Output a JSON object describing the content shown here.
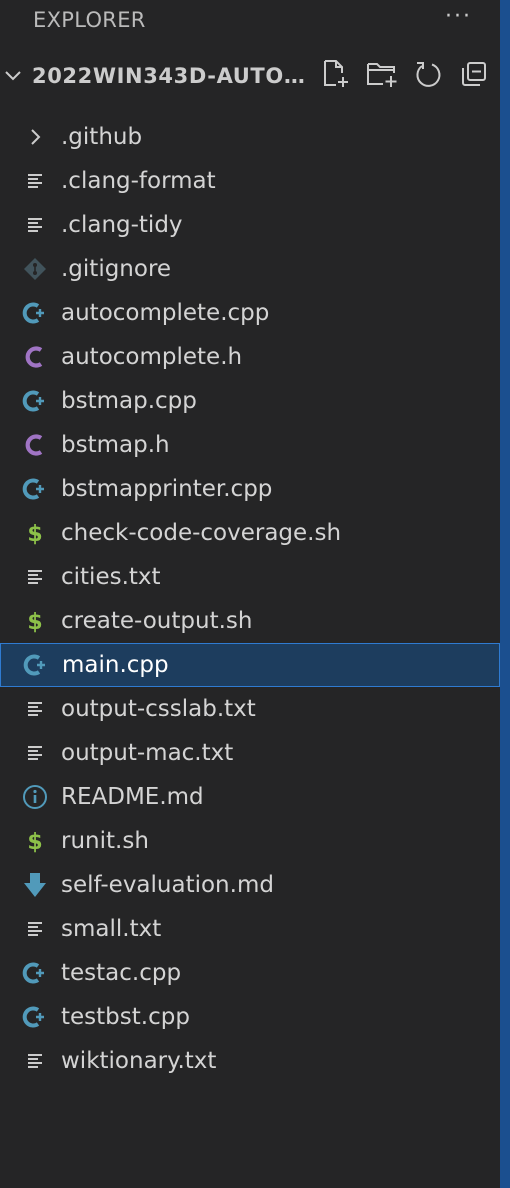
{
  "header": {
    "title": "EXPLORER",
    "more_label": "···"
  },
  "folder": {
    "name": "2022WIN343D-AUTOC...",
    "actions": [
      "new-file-icon",
      "new-folder-icon",
      "refresh-icon",
      "collapse-all-icon"
    ]
  },
  "files": [
    {
      "label": ".github",
      "icon": "chevron-right-icon",
      "kind": "folder"
    },
    {
      "label": ".clang-format",
      "icon": "text-file-icon",
      "kind": "file"
    },
    {
      "label": ".clang-tidy",
      "icon": "text-file-icon",
      "kind": "file"
    },
    {
      "label": ".gitignore",
      "icon": "git-icon",
      "kind": "file"
    },
    {
      "label": "autocomplete.cpp",
      "icon": "cpp-icon",
      "kind": "file"
    },
    {
      "label": "autocomplete.h",
      "icon": "c-header-icon",
      "kind": "file"
    },
    {
      "label": "bstmap.cpp",
      "icon": "cpp-icon",
      "kind": "file"
    },
    {
      "label": "bstmap.h",
      "icon": "c-header-icon",
      "kind": "file"
    },
    {
      "label": "bstmapprinter.cpp",
      "icon": "cpp-icon",
      "kind": "file"
    },
    {
      "label": "check-code-coverage.sh",
      "icon": "shell-icon",
      "kind": "file"
    },
    {
      "label": "cities.txt",
      "icon": "text-file-icon",
      "kind": "file"
    },
    {
      "label": "create-output.sh",
      "icon": "shell-icon",
      "kind": "file"
    },
    {
      "label": "main.cpp",
      "icon": "cpp-icon",
      "kind": "file",
      "selected": true
    },
    {
      "label": "output-csslab.txt",
      "icon": "text-file-icon",
      "kind": "file"
    },
    {
      "label": "output-mac.txt",
      "icon": "text-file-icon",
      "kind": "file"
    },
    {
      "label": "README.md",
      "icon": "info-icon",
      "kind": "file"
    },
    {
      "label": "runit.sh",
      "icon": "shell-icon",
      "kind": "file"
    },
    {
      "label": "self-evaluation.md",
      "icon": "markdown-download-icon",
      "kind": "file"
    },
    {
      "label": "small.txt",
      "icon": "text-file-icon",
      "kind": "file"
    },
    {
      "label": "testac.cpp",
      "icon": "cpp-icon",
      "kind": "file"
    },
    {
      "label": "testbst.cpp",
      "icon": "cpp-icon",
      "kind": "file"
    },
    {
      "label": "wiktionary.txt",
      "icon": "text-file-icon",
      "kind": "file"
    }
  ],
  "colors": {
    "background": "#252526",
    "selection": "#1d3d5e",
    "selection_border": "#2f7bd1",
    "cpp_icon": "#519aba",
    "c_header_icon": "#a074c4",
    "shell_icon": "#8dc149",
    "text_icon": "#cccccc"
  }
}
